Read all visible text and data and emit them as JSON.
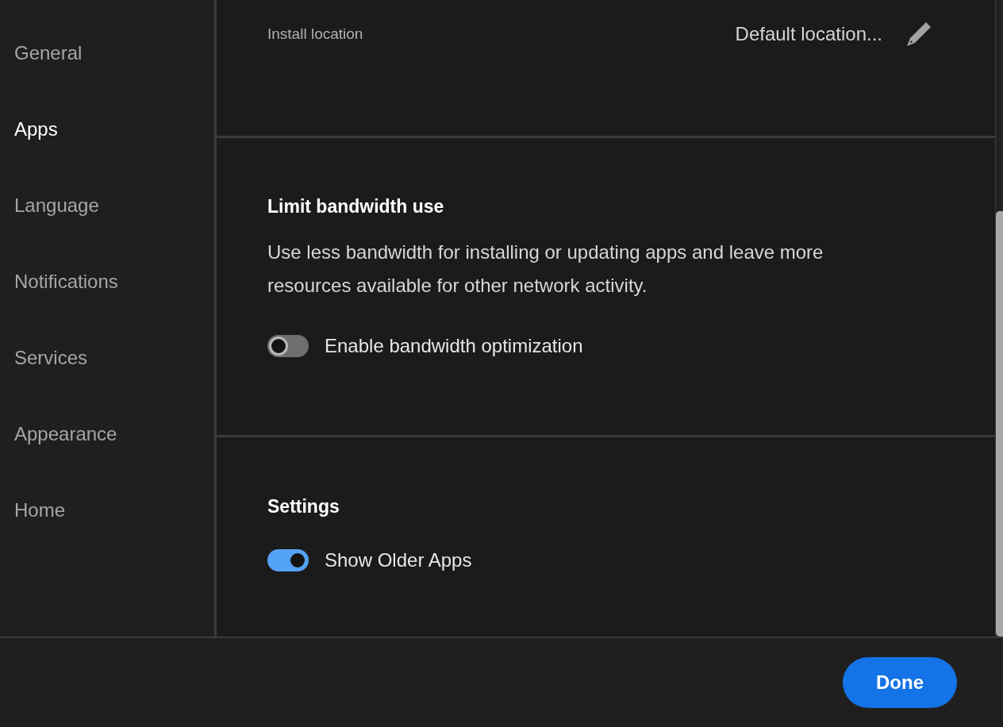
{
  "sidebar": {
    "items": [
      {
        "label": "General",
        "selected": false
      },
      {
        "label": "Apps",
        "selected": true
      },
      {
        "label": "Language",
        "selected": false
      },
      {
        "label": "Notifications",
        "selected": false
      },
      {
        "label": "Services",
        "selected": false
      },
      {
        "label": "Appearance",
        "selected": false
      },
      {
        "label": "Home",
        "selected": false
      }
    ]
  },
  "sections": [
    {
      "kind": "field",
      "label": "Install location",
      "value": "Default location..."
    },
    {
      "kind": "toggles",
      "title": "Limit bandwidth use",
      "description": "Use less bandwidth for installing or updating apps and leave more resources available for other network activity.",
      "toggles": [
        {
          "label": "Enable bandwidth optimization",
          "on": false
        }
      ]
    },
    {
      "kind": "toggles",
      "title": "Settings",
      "toggles": [
        {
          "label": "Show Older Apps",
          "on": true
        }
      ]
    }
  ],
  "footer": {
    "button": "Done"
  }
}
